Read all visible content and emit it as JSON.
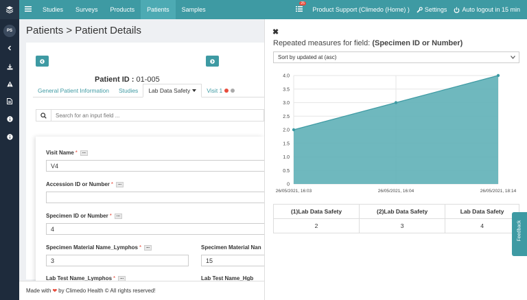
{
  "rail": {
    "avatar": "PS"
  },
  "topbar": {
    "nav": [
      "Studies",
      "Surveys",
      "Products",
      "Patients",
      "Samples"
    ],
    "active": "Patients",
    "notification_count": "25",
    "org": "Product Support (Climedo (Home) )",
    "settings": "Settings",
    "logout": "Auto logout in 15 min"
  },
  "breadcrumb": "Patients > Patient Details",
  "patient": {
    "id_label": "Patient ID :",
    "id_value": "01-005"
  },
  "tabs": [
    "General Patient Information",
    "Studies",
    "Lab Data Safety",
    "Visit 1"
  ],
  "search": {
    "placeholder": "Search for an input field ..."
  },
  "form": {
    "visit_name_label": "Visit Name",
    "visit_name_value": "V4",
    "accession_label": "Accession ID or Number",
    "accession_value": "",
    "specimen_id_label": "Specimen ID or Number",
    "specimen_id_value": "4",
    "material_lymphos_label": "Specimen Material Name_Lymphos",
    "material_lymphos_value": "3",
    "material_2_label": "Specimen Material Nan",
    "material_2_value": "15",
    "labtest_lymphos_label": "Lab Test Name_Lymphos",
    "labtest_hgb_label": "Lab Test Name_Hgb"
  },
  "footer": {
    "pre": "Made with",
    "post": "by Climedo Health © All rights reserved!"
  },
  "panel": {
    "title_pre": "Repeated measures for field:",
    "title_field": "(Specimen ID or Number)",
    "sort_label": "Sort by updated at (asc)"
  },
  "chart_data": {
    "type": "area",
    "x": [
      "26/05/2021, 16:03",
      "26/05/2021, 16:04",
      "26/05/2021, 18:14"
    ],
    "values": [
      2,
      3,
      4
    ],
    "yticks": [
      "0",
      "0.5",
      "1.0",
      "1.5",
      "2.0",
      "2.5",
      "3.0",
      "3.5",
      "4.0"
    ],
    "ylim": [
      0,
      4
    ],
    "grid": true,
    "fill_color": "#5fb0b7",
    "line_color": "#3e9aa3"
  },
  "table": {
    "headers": [
      "(1)Lab Data Safety",
      "(2)Lab Data Safety",
      "Lab Data Safety"
    ],
    "values": [
      "2",
      "3",
      "4"
    ]
  },
  "feedback": "Feedback",
  "colors": {
    "brand": "#3e9aa3",
    "rail": "#1e2b3c",
    "alert": "#e74c3c"
  }
}
